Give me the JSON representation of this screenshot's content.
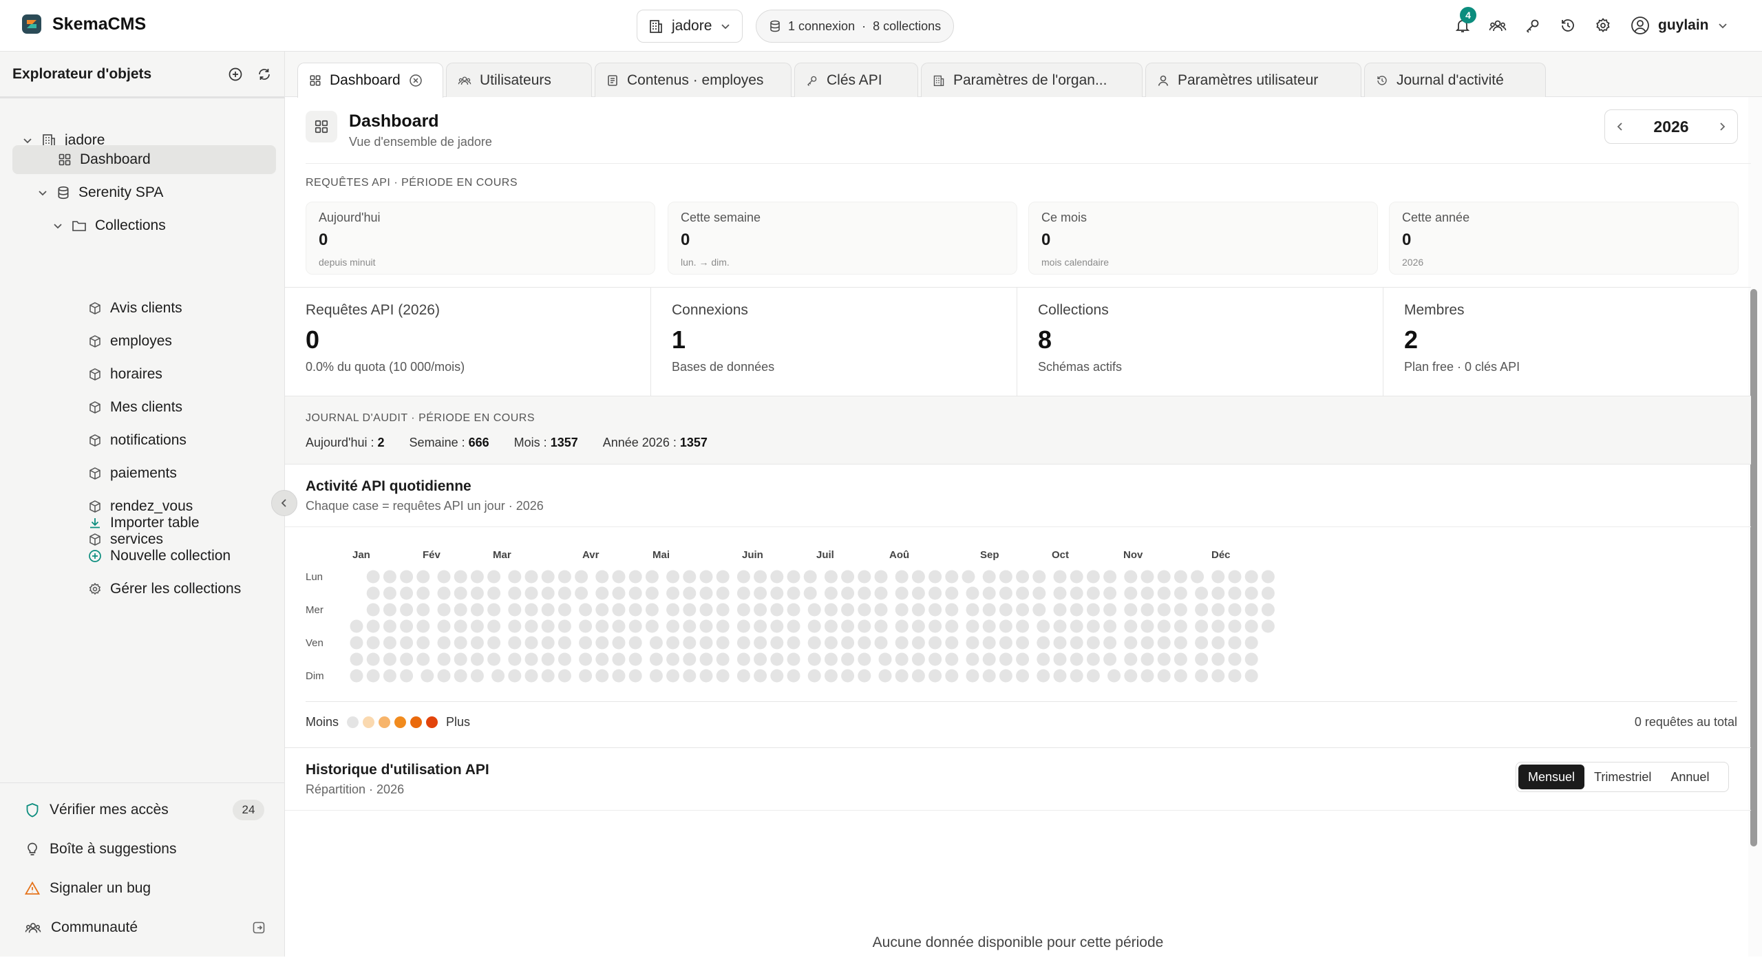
{
  "brand": {
    "name": "SkemaCMS"
  },
  "org_switch": {
    "label": "jadore"
  },
  "connection_pill": {
    "connections": "1 connexion",
    "separator": "·",
    "collections": "8 collections"
  },
  "top_actions": {
    "notification_count": "4",
    "user": "guylain"
  },
  "sidebar": {
    "title": "Explorateur d'objets",
    "root": "jadore",
    "dashboard": "Dashboard",
    "database": "Serenity SPA",
    "collections_folder": "Collections",
    "collections": [
      "Avis clients",
      "employes",
      "horaires",
      "Mes clients",
      "notifications",
      "paiements",
      "rendez_vous",
      "services"
    ],
    "actions": [
      "Importer table",
      "Nouvelle collection",
      "Gérer les collections"
    ],
    "footer": {
      "verify": "Vérifier mes accès",
      "verify_count": "24",
      "suggest": "Boîte à suggestions",
      "bug": "Signaler un bug",
      "community": "Communauté"
    }
  },
  "tabs": [
    "Dashboard",
    "Utilisateurs",
    "Contenus · employes",
    "Clés API",
    "Paramètres de l'organ...",
    "Paramètres utilisateur",
    "Journal d'activité"
  ],
  "header": {
    "title": "Dashboard",
    "subtitle": "Vue d'ensemble de jadore",
    "year": "2026"
  },
  "api_period": {
    "label": "Requêtes API · période en cours",
    "cards": [
      {
        "label": "Aujourd'hui",
        "value": "0",
        "sub": "depuis minuit"
      },
      {
        "label": "Cette semaine",
        "value": "0",
        "sub": "lun. → dim."
      },
      {
        "label": "Ce mois",
        "value": "0",
        "sub": "mois calendaire"
      },
      {
        "label": "Cette année",
        "value": "0",
        "sub": "2026"
      }
    ]
  },
  "stats": [
    {
      "label": "Requêtes API (2026)",
      "value": "0",
      "sub": "0.0% du quota (10 000/mois)"
    },
    {
      "label": "Connexions",
      "value": "1",
      "sub": "Bases de données"
    },
    {
      "label": "Collections",
      "value": "8",
      "sub": "Schémas actifs"
    },
    {
      "label": "Membres",
      "value": "2",
      "sub": "Plan free · 0 clés API"
    }
  ],
  "audit": {
    "label": "Journal d'audit · période en cours",
    "today_label": "Aujourd'hui :",
    "today": "2",
    "week_label": "Semaine :",
    "week": "666",
    "month_label": "Mois :",
    "month": "1357",
    "year_label": "Année 2026 :",
    "year": "1357"
  },
  "activity": {
    "title": "Activité API quotidienne",
    "subtitle": "Chaque case = requêtes API un jour · 2026",
    "months": [
      "Jan",
      "Fév",
      "Mar",
      "Avr",
      "Mai",
      "Juin",
      "Juil",
      "Aoû",
      "Sep",
      "Oct",
      "Nov",
      "Déc"
    ],
    "days": [
      "Lun",
      "Mer",
      "Ven",
      "Dim"
    ],
    "legend_less": "Moins",
    "legend_more": "Plus",
    "legend_colors": [
      "#e4e4e4",
      "#fad9b0",
      "#f7b46a",
      "#f18b1e",
      "#ea6a0c",
      "#e2440b"
    ],
    "total": "0 requêtes au total"
  },
  "chart_data": {
    "type": "heatmap",
    "title": "Activité API quotidienne",
    "year": 2026,
    "rows": [
      "Lun",
      "Mar",
      "Mer",
      "Jeu",
      "Ven",
      "Sam",
      "Dim"
    ],
    "total": 0,
    "values": "all days 0"
  },
  "history": {
    "title": "Historique d'utilisation API",
    "subtitle": "Répartition · 2026",
    "segments": [
      "Mensuel",
      "Trimestriel",
      "Annuel"
    ],
    "selected": "Mensuel",
    "empty": "Aucune donnée disponible pour cette période"
  }
}
